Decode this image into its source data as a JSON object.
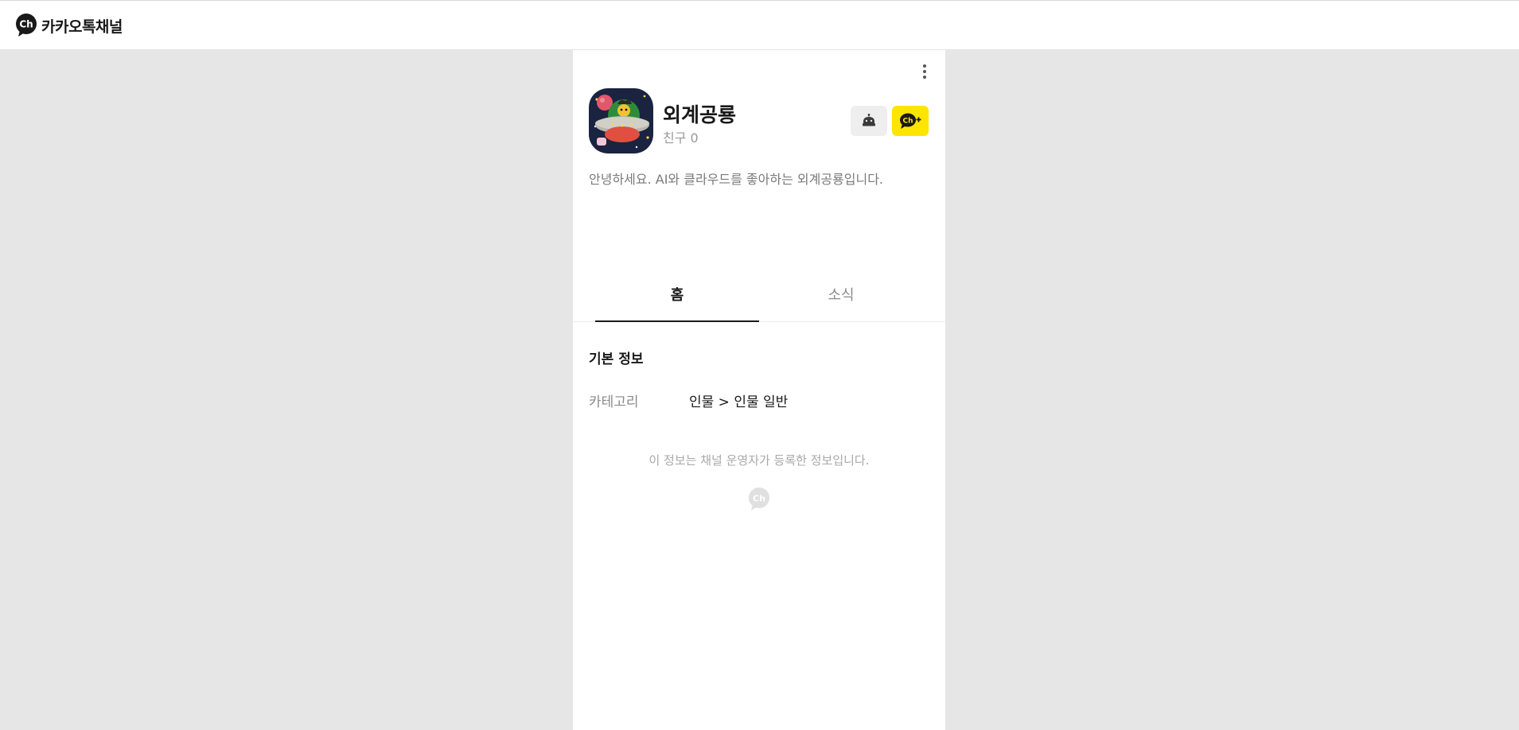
{
  "header": {
    "logo_text": "카카오톡채널",
    "logo_icon": "ch-logo-icon"
  },
  "channel": {
    "name": "외계공룡",
    "friends": "친구 0",
    "description": "안녕하세요. AI와 클라우드를 좋아하는 외계공룡입니다."
  },
  "actions": {
    "more_icon": "kebab-menu-icon",
    "bot_icon": "chatbot-icon",
    "add_icon": "add-channel-icon"
  },
  "tabs": [
    {
      "label": "홈",
      "active": true
    },
    {
      "label": "소식",
      "active": false
    }
  ],
  "basic_info": {
    "title": "기본 정보",
    "category_label": "카테고리",
    "category_value": "인물 > 인물 일반"
  },
  "notice": "이 정보는 채널 운영자가 등록한 정보입니다.",
  "colors": {
    "accent_yellow": "#fee500",
    "background": "#e6e6e6",
    "text_primary": "#191919",
    "text_secondary": "#8a8a8a"
  }
}
